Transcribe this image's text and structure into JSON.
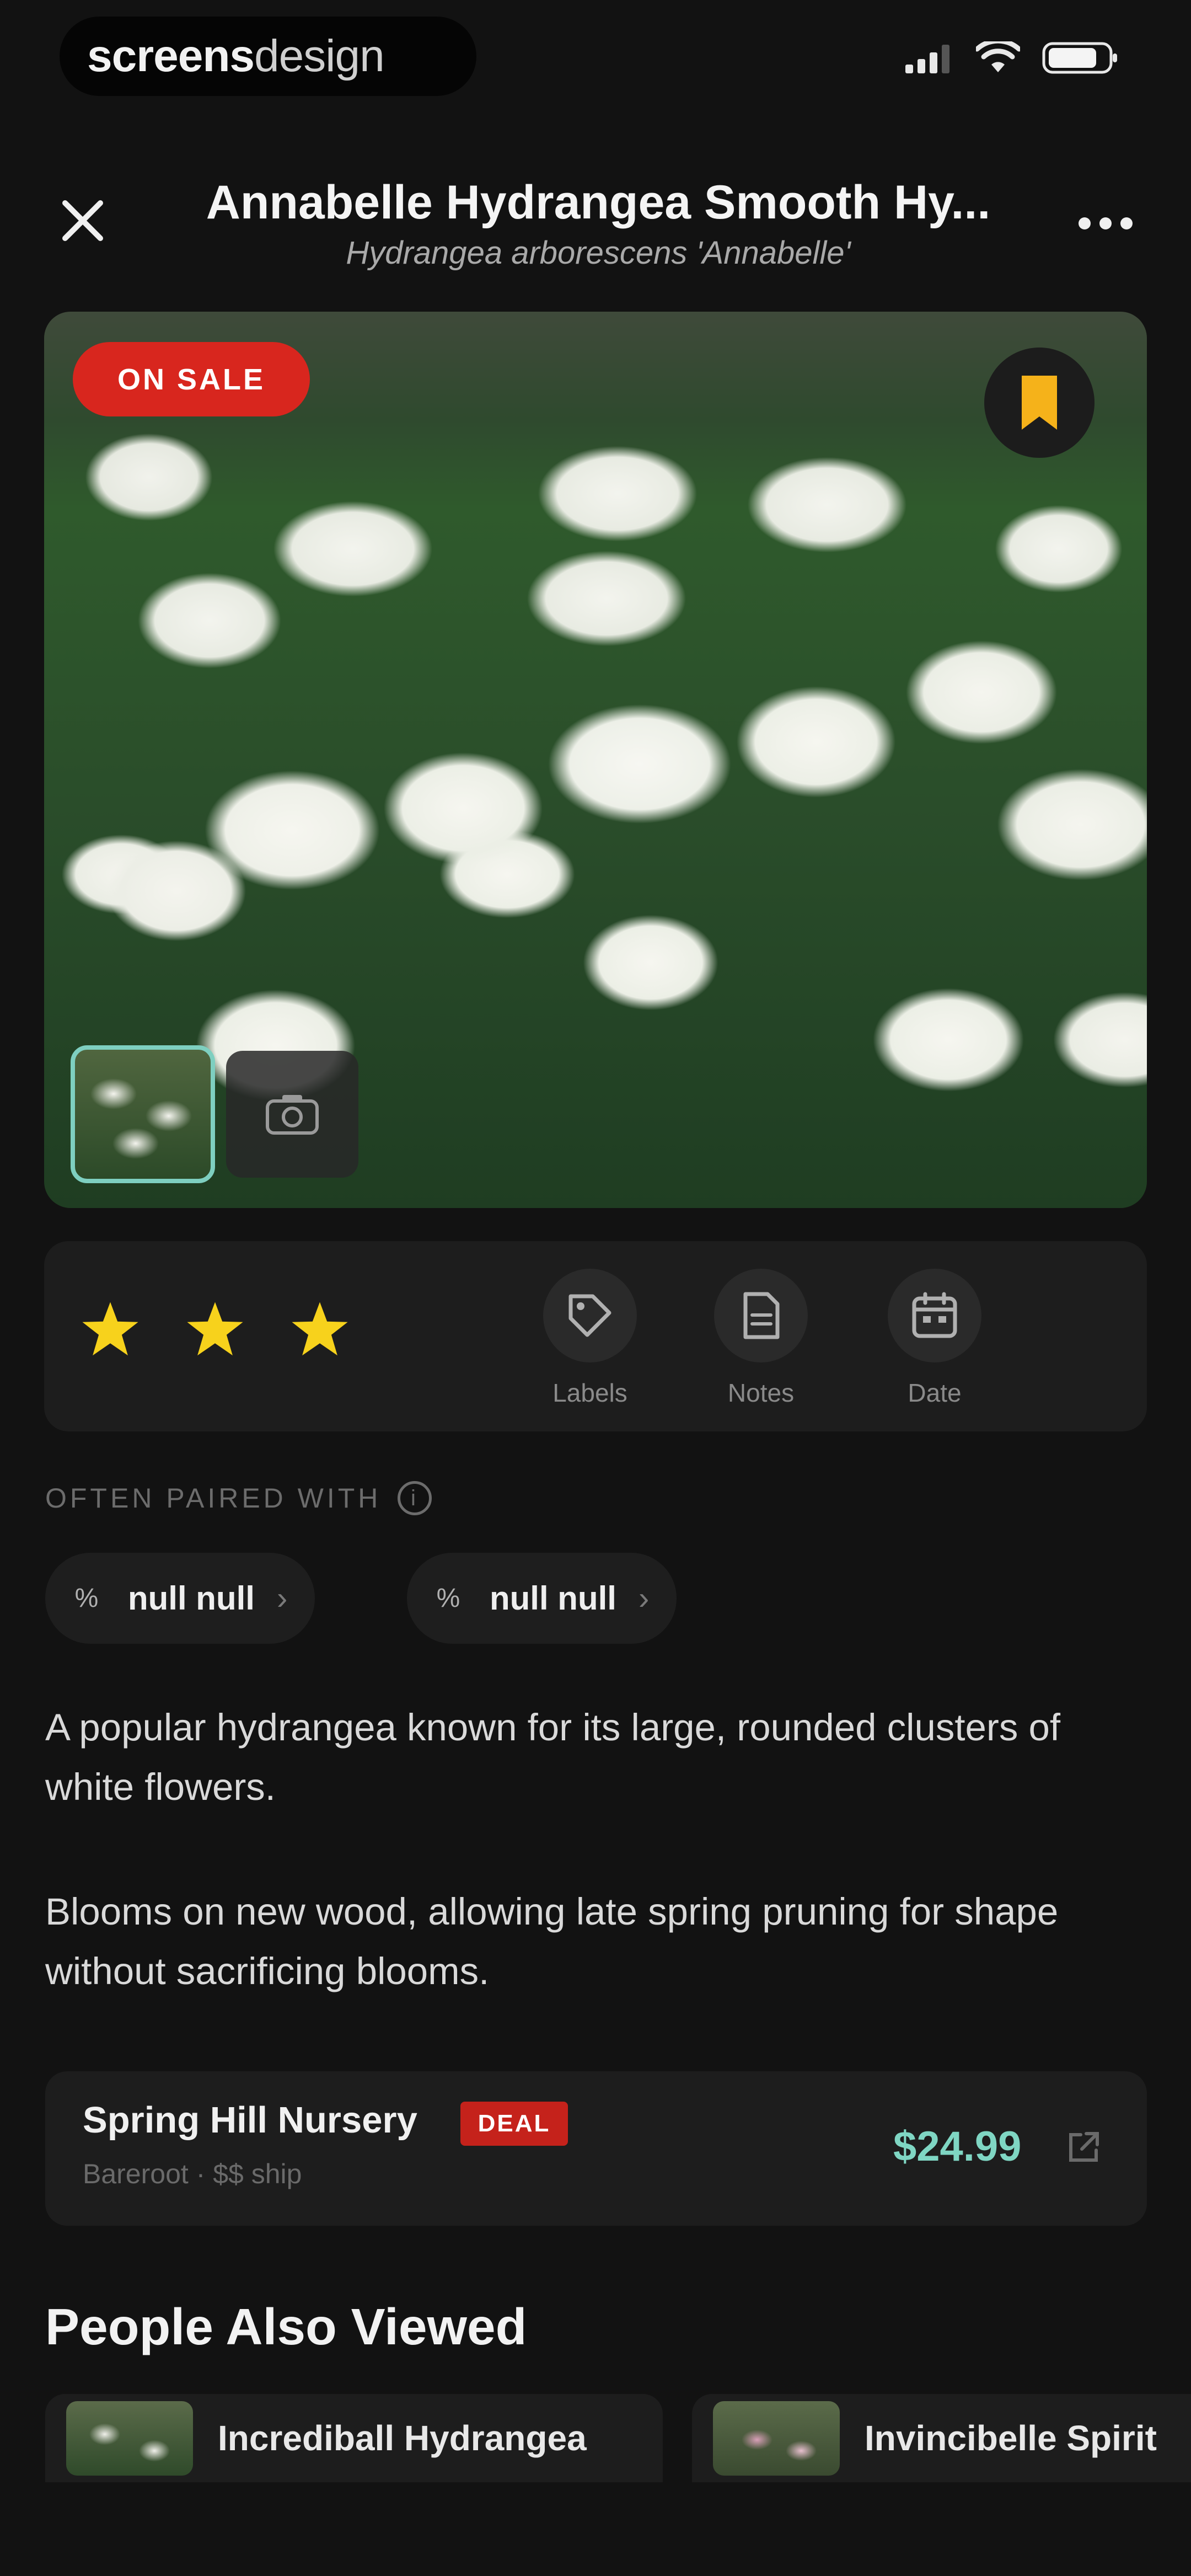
{
  "status_bar": {
    "brand_bold": "screens",
    "brand_light": "design"
  },
  "header": {
    "title": "Annabelle Hydrangea Smooth Hy...",
    "subtitle": "Hydrangea arborescens 'Annabelle'"
  },
  "hero": {
    "sale_badge": "ON SALE",
    "bookmarked": true,
    "accent_color": "#f5b21a"
  },
  "rating": {
    "stars": 3,
    "star_color": "#f7d21c"
  },
  "actions": [
    {
      "label": "Labels",
      "icon": "tag-icon"
    },
    {
      "label": "Notes",
      "icon": "note-icon"
    },
    {
      "label": "Date",
      "icon": "calendar-icon"
    }
  ],
  "often_paired": {
    "title": "OFTEN PAIRED WITH",
    "chips": [
      {
        "pct": "%",
        "name": "null null"
      },
      {
        "pct": "%",
        "name": "null null"
      }
    ]
  },
  "description": {
    "p1": "A popular hydrangea known for its large, rounded clusters of white flowers.",
    "p2": "Blooms on new wood, allowing late spring pruning for shape without sacrificing blooms."
  },
  "nursery": {
    "name": "Spring Hill Nursery",
    "badge": "DEAL",
    "meta": "Bareroot · $$ ship",
    "price": "$24.99",
    "price_color": "#7fd6c3"
  },
  "people_also_viewed": {
    "title": "People Also Viewed",
    "items": [
      {
        "name": "Incrediball Hydrangea"
      },
      {
        "name": "Invincibelle Spirit"
      }
    ]
  }
}
